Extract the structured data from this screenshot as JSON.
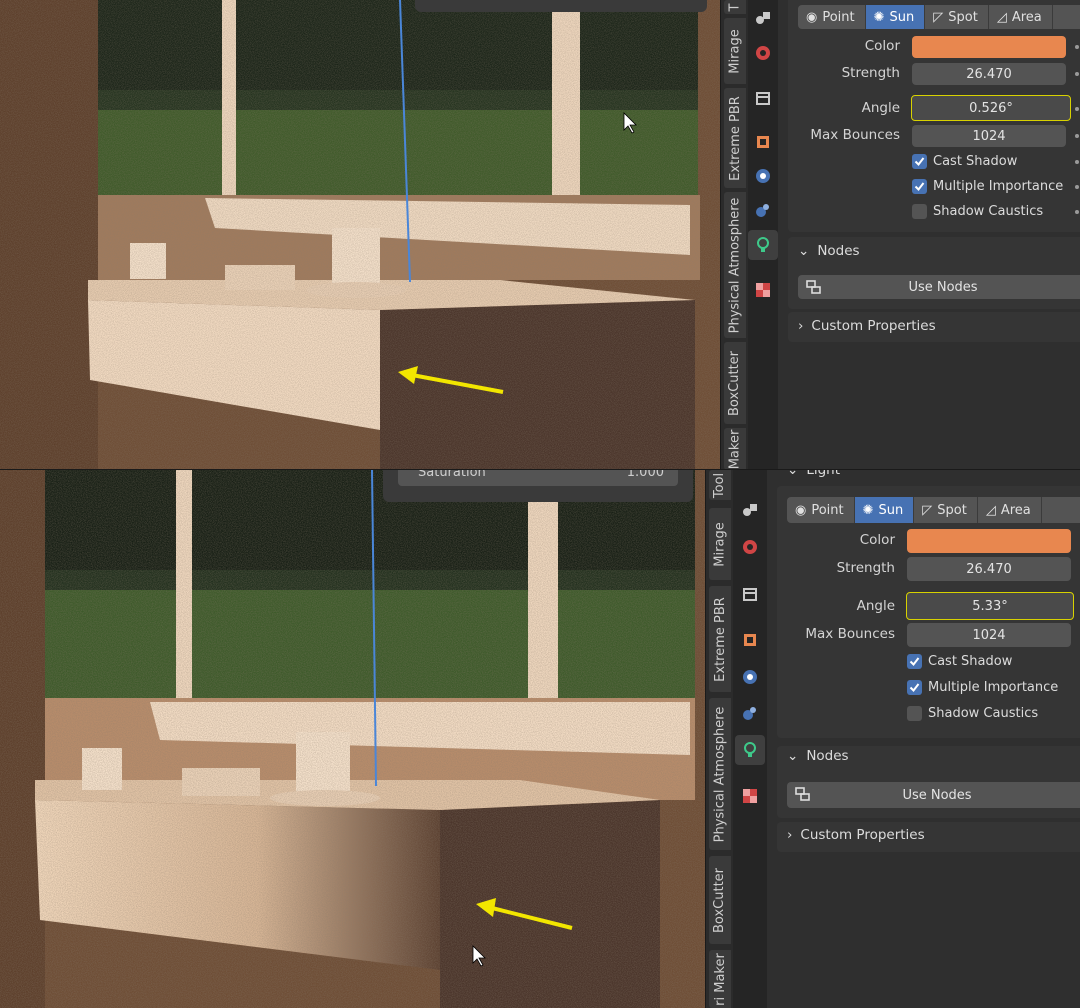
{
  "panels": [
    {
      "id": "top",
      "light_types": [
        "Point",
        "Sun",
        "Spot",
        "Area"
      ],
      "active_type": "Sun",
      "color_label": "Color",
      "strength_label": "Strength",
      "strength_value": "26.470",
      "angle_label": "Angle",
      "angle_value": "0.526°",
      "max_bounces_label": "Max Bounces",
      "max_bounces_value": "1024",
      "cast_shadow": "Cast Shadow",
      "multiple_importance": "Multiple Importance",
      "shadow_caustics": "Shadow Caustics",
      "nodes_header": "Nodes",
      "use_nodes": "Use Nodes",
      "custom_properties": "Custom Properties",
      "tabs": [
        "T",
        "Mirage",
        "Extreme PBR",
        "Physical Atmosphere",
        "BoxCutter",
        "Maker"
      ]
    },
    {
      "id": "bottom",
      "light_types": [
        "Point",
        "Sun",
        "Spot",
        "Area"
      ],
      "active_type": "Sun",
      "light_header": "Light",
      "saturation_label": "Saturation",
      "saturation_value": "1.000",
      "color_label": "Color",
      "strength_label": "Strength",
      "strength_value": "26.470",
      "angle_label": "Angle",
      "angle_value": "5.33°",
      "max_bounces_label": "Max Bounces",
      "max_bounces_value": "1024",
      "cast_shadow": "Cast Shadow",
      "multiple_importance": "Multiple Importance",
      "shadow_caustics": "Shadow Caustics",
      "nodes_header": "Nodes",
      "use_nodes": "Use Nodes",
      "custom_properties": "Custom Properties",
      "tabs": [
        "Tool",
        "Mirage",
        "Extreme PBR",
        "Physical Atmosphere",
        "BoxCutter",
        "ri Maker"
      ]
    }
  ],
  "colors": {
    "light_color": "#e8874f",
    "accent": "#4772b3",
    "highlight_border": "#d8d200",
    "arrow": "#f2e600"
  }
}
